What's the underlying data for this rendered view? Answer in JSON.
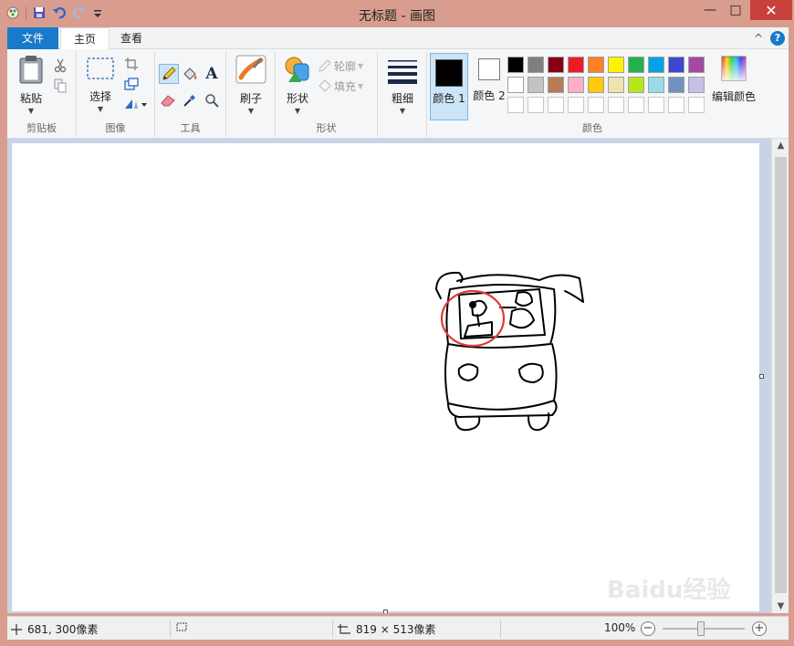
{
  "window": {
    "title": "无标题 - 画图",
    "minimize": "—",
    "maximize": "□",
    "close": "✕"
  },
  "tabs": [
    {
      "label": "文件",
      "active": false
    },
    {
      "label": "主页",
      "active": true
    },
    {
      "label": "查看",
      "active": false
    }
  ],
  "help": {
    "collapse": "^",
    "icon": "?"
  },
  "ribbon": {
    "clipboard": {
      "label": "剪贴板",
      "paste": "粘贴"
    },
    "image": {
      "label": "图像",
      "select": "选择"
    },
    "tools": {
      "label": "工具"
    },
    "brushes": {
      "label": "刷子"
    },
    "shapes": {
      "label": "形状",
      "shapes_btn": "形状",
      "outline": "轮廓",
      "fill": "填充"
    },
    "size": {
      "label": "粗细"
    },
    "colors": {
      "label": "颜色",
      "color1": "颜色 1",
      "color2": "颜色 2",
      "edit": "编辑颜色",
      "color1_value": "#000000",
      "color2_value": "#ffffff",
      "palette_row1": [
        "#000000",
        "#7f7f7f",
        "#880015",
        "#ed1c24",
        "#ff7f27",
        "#fff200",
        "#22b14c",
        "#00a2e8",
        "#3f48cc",
        "#a349a4"
      ],
      "palette_row2": [
        "#ffffff",
        "#c3c3c3",
        "#b97a57",
        "#ffaec9",
        "#ffc90e",
        "#efe4b0",
        "#b5e61d",
        "#99d9ea",
        "#7092be",
        "#c8bfe7"
      ]
    }
  },
  "status": {
    "cursor_pos": "681, 300像素",
    "canvas_size": "819 × 513像素",
    "zoom": "100%",
    "zoom_level": 1.0
  },
  "watermark": "Baidu经验"
}
